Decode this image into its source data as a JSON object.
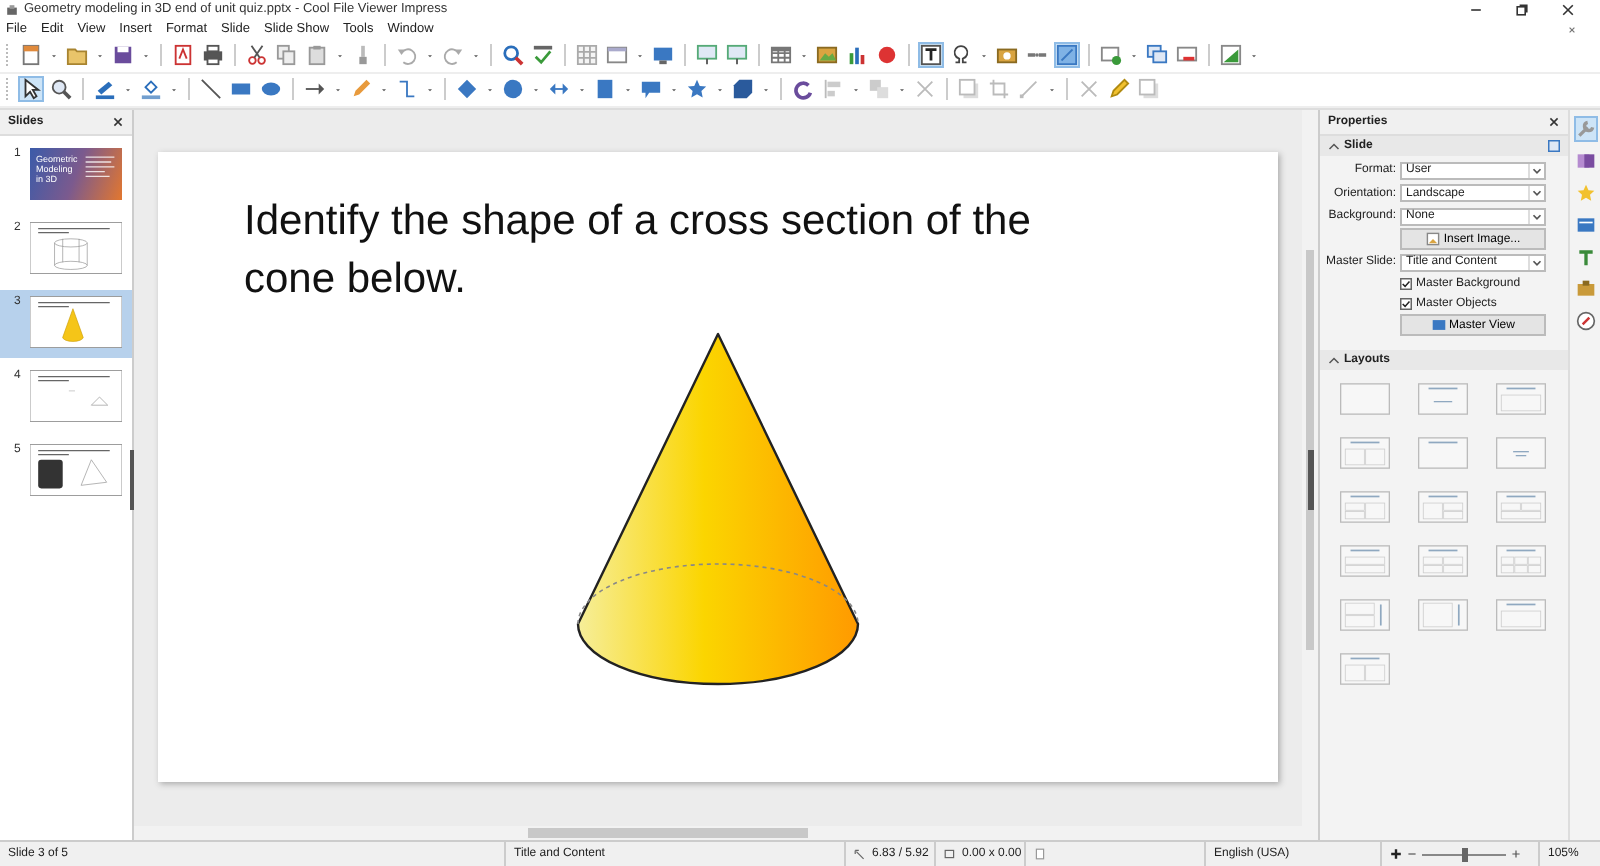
{
  "window": {
    "title": "Geometry modeling in 3D end of unit quiz.pptx - Cool File Viewer Impress"
  },
  "menu": [
    "File",
    "Edit",
    "View",
    "Insert",
    "Format",
    "Slide",
    "Slide Show",
    "Tools",
    "Window"
  ],
  "toolbars": [
    [
      {
        "kind": "new",
        "selected": false
      },
      {
        "kind": "caret",
        "selected": false
      },
      {
        "kind": "open",
        "selected": false
      },
      {
        "kind": "caret",
        "selected": false
      },
      {
        "kind": "save",
        "selected": false
      },
      {
        "kind": "caret",
        "selected": false
      },
      {
        "kind": "sep"
      },
      {
        "kind": "pdf",
        "selected": false
      },
      {
        "kind": "print",
        "selected": false
      },
      {
        "kind": "sep"
      },
      {
        "kind": "cut",
        "selected": false
      },
      {
        "kind": "copy",
        "selected": false
      },
      {
        "kind": "paste",
        "selected": false
      },
      {
        "kind": "caret",
        "selected": false
      },
      {
        "kind": "brush",
        "selected": false
      },
      {
        "kind": "sep"
      },
      {
        "kind": "undo",
        "selected": false
      },
      {
        "kind": "caret",
        "selected": false
      },
      {
        "kind": "redo",
        "selected": false
      },
      {
        "kind": "caret",
        "selected": false
      },
      {
        "kind": "sep"
      },
      {
        "kind": "find",
        "selected": false
      },
      {
        "kind": "spell",
        "selected": false
      },
      {
        "kind": "sep"
      },
      {
        "kind": "grid",
        "selected": false
      },
      {
        "kind": "panel",
        "selected": false
      },
      {
        "kind": "caret",
        "selected": false
      },
      {
        "kind": "monitor",
        "selected": false
      },
      {
        "kind": "sep"
      },
      {
        "kind": "present",
        "selected": false
      },
      {
        "kind": "present",
        "selected": false
      },
      {
        "kind": "sep"
      },
      {
        "kind": "table",
        "selected": false
      },
      {
        "kind": "caret",
        "selected": false
      },
      {
        "kind": "image",
        "selected": false
      },
      {
        "kind": "chart",
        "selected": false
      },
      {
        "kind": "media",
        "selected": false
      },
      {
        "kind": "sep"
      },
      {
        "kind": "textbox",
        "selected": true
      },
      {
        "kind": "symbol",
        "selected": false
      },
      {
        "kind": "caret",
        "selected": false
      },
      {
        "kind": "camera",
        "selected": false
      },
      {
        "kind": "link",
        "selected": false
      },
      {
        "kind": "draw",
        "selected": true
      },
      {
        "kind": "sep"
      },
      {
        "kind": "slide_new",
        "selected": false
      },
      {
        "kind": "caret",
        "selected": false
      },
      {
        "kind": "duplicate",
        "selected": false
      },
      {
        "kind": "delete",
        "selected": false
      },
      {
        "kind": "sep"
      },
      {
        "kind": "layout",
        "selected": false
      },
      {
        "kind": "caret",
        "selected": false
      }
    ],
    [
      {
        "kind": "pointer",
        "selected": true
      },
      {
        "kind": "zoom",
        "selected": false
      },
      {
        "kind": "sep"
      },
      {
        "kind": "linecolor",
        "selected": false
      },
      {
        "kind": "caret",
        "selected": false
      },
      {
        "kind": "fill",
        "selected": false
      },
      {
        "kind": "caret",
        "selected": false
      },
      {
        "kind": "sep"
      },
      {
        "kind": "line",
        "selected": false
      },
      {
        "kind": "rect",
        "selected": false
      },
      {
        "kind": "ellipse",
        "selected": false
      },
      {
        "kind": "sep"
      },
      {
        "kind": "arrow",
        "selected": false
      },
      {
        "kind": "caret",
        "selected": false
      },
      {
        "kind": "pen",
        "selected": false
      },
      {
        "kind": "caret",
        "selected": false
      },
      {
        "kind": "connector",
        "selected": false
      },
      {
        "kind": "caret",
        "selected": false
      },
      {
        "kind": "sep"
      },
      {
        "kind": "diamond",
        "selected": false
      },
      {
        "kind": "caret",
        "selected": false
      },
      {
        "kind": "circle",
        "selected": false
      },
      {
        "kind": "caret",
        "selected": false
      },
      {
        "kind": "dblarrow",
        "selected": false
      },
      {
        "kind": "caret",
        "selected": false
      },
      {
        "kind": "flowchart",
        "selected": false
      },
      {
        "kind": "caret",
        "selected": false
      },
      {
        "kind": "callout",
        "selected": false
      },
      {
        "kind": "caret",
        "selected": false
      },
      {
        "kind": "star",
        "selected": false
      },
      {
        "kind": "caret",
        "selected": false
      },
      {
        "kind": "cube",
        "selected": false
      },
      {
        "kind": "caret",
        "selected": false
      },
      {
        "kind": "sep"
      },
      {
        "kind": "rotate",
        "selected": false
      },
      {
        "kind": "align",
        "selected": false
      },
      {
        "kind": "caret",
        "selected": false
      },
      {
        "kind": "arrange",
        "selected": false
      },
      {
        "kind": "caret",
        "selected": false
      },
      {
        "kind": "glue",
        "selected": false
      },
      {
        "kind": "sep"
      },
      {
        "kind": "shadow",
        "selected": false
      },
      {
        "kind": "crop",
        "selected": false
      },
      {
        "kind": "points",
        "selected": false
      },
      {
        "kind": "caret",
        "selected": false
      },
      {
        "kind": "sep"
      },
      {
        "kind": "glue",
        "selected": false
      },
      {
        "kind": "pencil",
        "selected": false
      },
      {
        "kind": "shadow",
        "selected": false
      }
    ]
  ],
  "slides_panel": {
    "title": "Slides",
    "slides": [
      {
        "number": "1",
        "kind": "title",
        "title": "Geometric Modeling in 3D",
        "selected": false
      },
      {
        "number": "2",
        "kind": "prism",
        "selected": false
      },
      {
        "number": "3",
        "kind": "cone",
        "selected": true
      },
      {
        "number": "4",
        "kind": "triangle",
        "selected": false
      },
      {
        "number": "5",
        "kind": "image",
        "selected": false
      }
    ]
  },
  "slide": {
    "title": "Identify the shape of a cross section of the cone below."
  },
  "sidebar": {
    "title": "Properties",
    "slide_section": {
      "title": "Slide",
      "expanded": true,
      "fields": [
        {
          "label": "Format:",
          "value": "User"
        },
        {
          "label": "Orientation:",
          "value": "Landscape"
        },
        {
          "label": "Background:",
          "value": "None"
        }
      ],
      "insert_button": "Insert Image...",
      "master_label": "Master Slide:",
      "master_value": "Title and Content",
      "checkboxes": [
        {
          "label": "Master Background",
          "checked": true
        },
        {
          "label": "Master Objects",
          "checked": true
        }
      ],
      "master_button": "Master View"
    },
    "layouts_section": {
      "title": "Layouts",
      "expanded": true,
      "layouts": [
        {
          "kind": "blank"
        },
        {
          "kind": "title-slide"
        },
        {
          "kind": "title-content"
        },
        {
          "kind": "title-2-content"
        },
        {
          "kind": "title-only"
        },
        {
          "kind": "centered-text"
        },
        {
          "kind": "title-2-content-and-content"
        },
        {
          "kind": "title-content-and-2-content"
        },
        {
          "kind": "title-2-content-over-content"
        },
        {
          "kind": "title-content-over-content"
        },
        {
          "kind": "title-4-content"
        },
        {
          "kind": "title-6-content"
        },
        {
          "kind": "vertical-title-2-content"
        },
        {
          "kind": "vertical-title-content"
        },
        {
          "kind": "title-vertical-content"
        },
        {
          "kind": "title-2-content"
        }
      ]
    }
  },
  "deck": [
    {
      "kind": "wrench",
      "selected": true
    },
    {
      "kind": "transition",
      "selected": false
    },
    {
      "kind": "animation",
      "selected": false
    },
    {
      "kind": "master",
      "selected": false
    },
    {
      "kind": "styles",
      "selected": false
    },
    {
      "kind": "gallery",
      "selected": false
    },
    {
      "kind": "navigator",
      "selected": false
    }
  ],
  "status_bar": {
    "slide": "Slide 3 of 5",
    "layout": "Title and Content",
    "position": "6.83 / 5.92",
    "size": "0.00 x 0.00",
    "language": "English (USA)",
    "zoom": {
      "level": 0.5,
      "reading": "105%"
    }
  }
}
